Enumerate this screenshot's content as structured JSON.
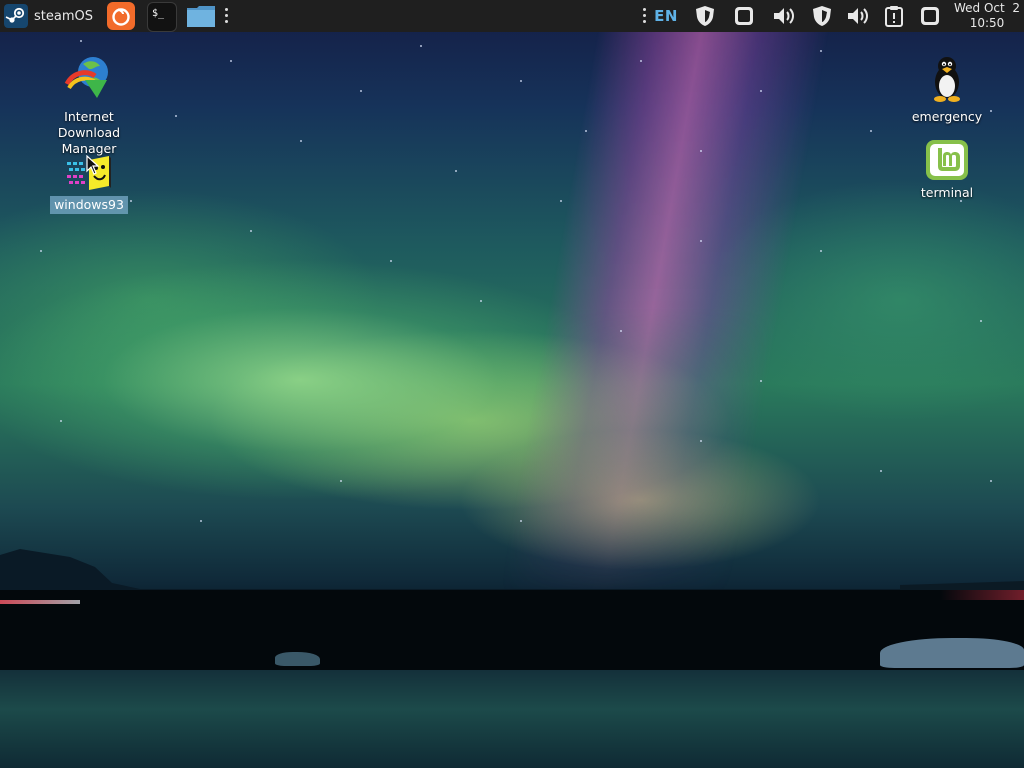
{
  "panel": {
    "launcher_label": "steamOS",
    "language": "EN",
    "clock": {
      "date": "Wed Oct  2",
      "time": "10:50"
    }
  },
  "desktop": {
    "icons_left": [
      {
        "label": "Internet Download Manager",
        "icon": "idm-icon"
      },
      {
        "label": "windows93",
        "icon": "windows93-icon",
        "selected": true
      }
    ],
    "icons_right": [
      {
        "label": "emergency",
        "icon": "tux-penguin-icon"
      },
      {
        "label": "terminal",
        "icon": "linux-mint-icon"
      }
    ]
  },
  "colors": {
    "panel_bg": "#1f1f1f",
    "accent_blue": "#5fb2e6",
    "firefox_orange": "#f26b2a",
    "folder_blue": "#6fb3e0",
    "mint_green": "#87c04a",
    "selection": "#78aac8"
  }
}
